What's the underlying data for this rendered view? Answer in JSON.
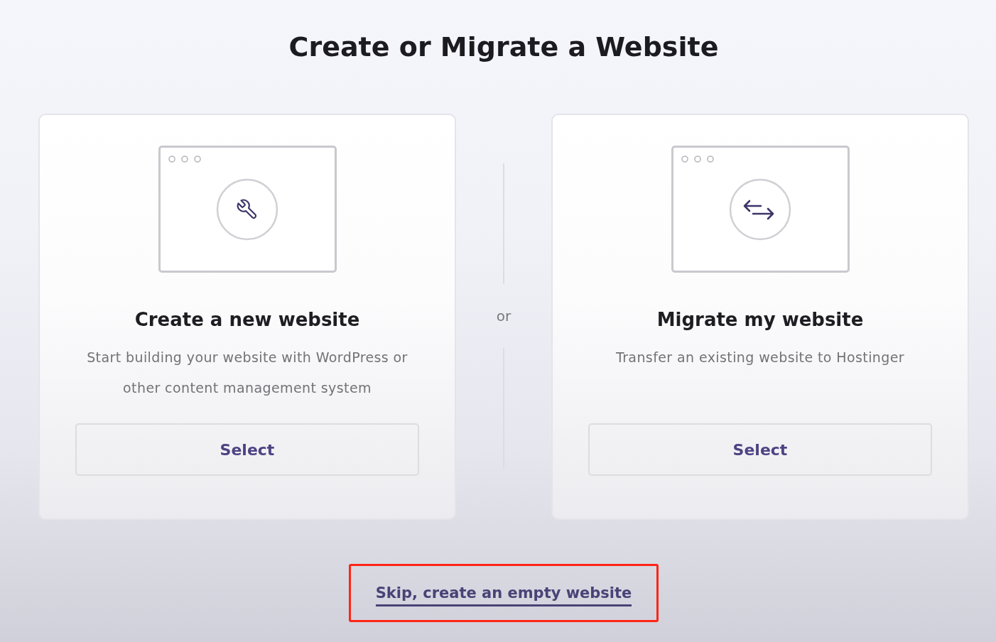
{
  "page": {
    "title": "Create or Migrate a Website"
  },
  "options": [
    {
      "kind": "build",
      "title": "Create a new website",
      "description": "Start building your website with WordPress or other content management system",
      "button": "Select"
    },
    {
      "kind": "migrate",
      "title": "Migrate my website",
      "description": "Transfer an existing website to Hostinger",
      "button": "Select"
    }
  ],
  "separator": {
    "label": "or"
  },
  "skip_link": {
    "label": "Skip, create an empty website",
    "highlighted": true
  }
}
